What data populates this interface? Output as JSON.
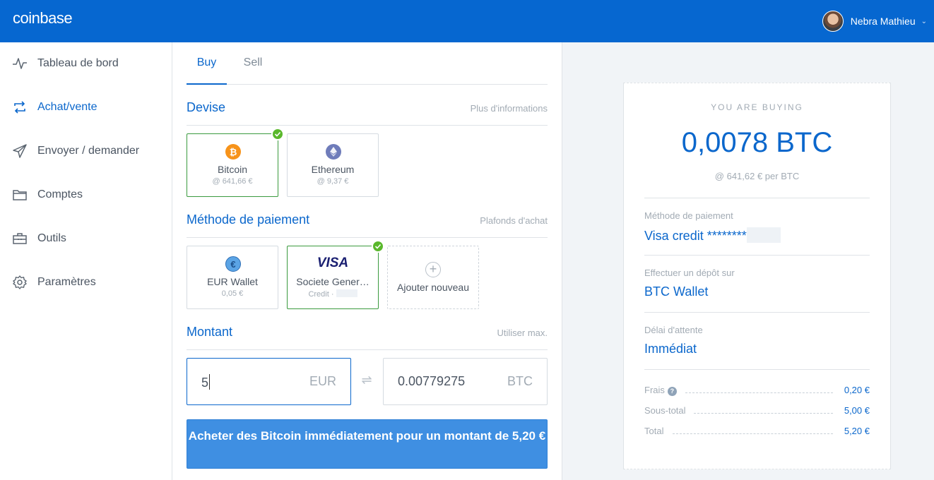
{
  "header": {
    "logo": "coinbase",
    "user_name": "Nebra Mathieu"
  },
  "sidebar": {
    "items": [
      {
        "label": "Tableau de bord",
        "icon": "activity-icon",
        "active": false
      },
      {
        "label": "Achat/vente",
        "icon": "refresh-icon",
        "active": true
      },
      {
        "label": "Envoyer / demander",
        "icon": "send-icon",
        "active": false
      },
      {
        "label": "Comptes",
        "icon": "folder-icon",
        "active": false
      },
      {
        "label": "Outils",
        "icon": "toolbox-icon",
        "active": false
      },
      {
        "label": "Paramètres",
        "icon": "gear-icon",
        "active": false
      }
    ]
  },
  "tabs": {
    "buy": "Buy",
    "sell": "Sell",
    "active": "Buy"
  },
  "currency": {
    "title": "Devise",
    "link": "Plus d'informations",
    "options": [
      {
        "name": "Bitcoin",
        "price": "@ 641,66 €",
        "selected": true,
        "color": "#f7931a"
      },
      {
        "name": "Ethereum",
        "price": "@ 9,37 €",
        "selected": false,
        "color": "#6f7cba"
      }
    ]
  },
  "payment": {
    "title": "Méthode de paiement",
    "link": "Plafonds d'achat",
    "options": [
      {
        "name": "EUR Wallet",
        "sub": "0,05 €",
        "selected": false
      },
      {
        "brand": "VISA",
        "name": "Societe Gener…",
        "sub": "Credit ·",
        "selected": true
      },
      {
        "name": "Ajouter nouveau",
        "selected": false
      }
    ]
  },
  "amount": {
    "title": "Montant",
    "link": "Utiliser max.",
    "fiat_value": "5",
    "fiat_unit": "EUR",
    "crypto_value": "0.00779275",
    "crypto_unit": "BTC"
  },
  "buy_button": "Acheter des Bitcoin immédiatement pour un montant de 5,20 €",
  "summary": {
    "eyebrow": "YOU ARE BUYING",
    "amount": "0,0078 BTC",
    "rate": "@ 641,62 € per BTC",
    "payment_label": "Méthode de paiement",
    "payment_value": "Visa credit ********",
    "deposit_label": "Effectuer un dépôt sur",
    "deposit_value": "BTC Wallet",
    "delay_label": "Délai d'attente",
    "delay_value": "Immédiat",
    "fees": [
      {
        "label": "Frais",
        "value": "0,20 €"
      },
      {
        "label": "Sous-total",
        "value": "5,00 €"
      },
      {
        "label": "Total",
        "value": "5,20 €"
      }
    ]
  },
  "colors": {
    "brand": "#0667d0",
    "accent": "#0b67cc",
    "success": "#5ab82c",
    "button": "#3f8fe2"
  }
}
